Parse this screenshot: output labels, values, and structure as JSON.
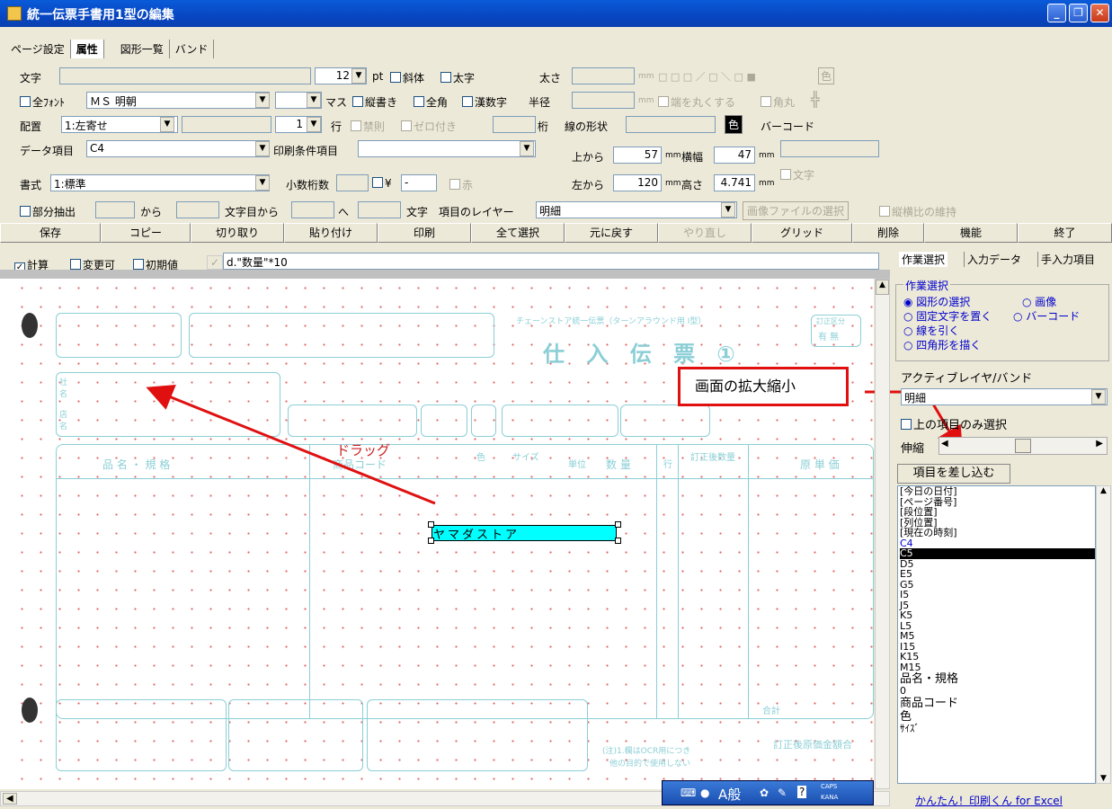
{
  "window": {
    "title": "統一伝票手書用1型の編集"
  },
  "top_tabs": [
    "ページ設定",
    "属性",
    "図形一覧",
    "バンド"
  ],
  "attr": {
    "moji_label": "文字",
    "size_value": "12",
    "pt_label": "pt",
    "italic_label": "斜体",
    "bold_label": "太字",
    "thickness_label": "太さ",
    "mm_label": "mm",
    "color_label": "色",
    "allfont_label": "全ﾌｫﾝﾄ",
    "font_value": "ＭＳ 明朝",
    "masu_label": "マス",
    "vertical_label": "縦書き",
    "fullwidth_label": "全角",
    "kanji_num_label": "漢数字",
    "radius_label": "半径",
    "round_end_label": "端を丸くする",
    "round_corner_label": "角丸",
    "align_label": "配置",
    "align_value": "1:左寄せ",
    "line_count": "1",
    "row_label": "行",
    "kinsoku_label": "禁則",
    "zero_label": "ゼロ付き",
    "digit_label": "桁",
    "line_shape_label": "線の形状",
    "barcode_label": "バーコード",
    "data_item_label": "データ項目",
    "data_item_value": "C4",
    "print_cond_label": "印刷条件項目",
    "from_top_label": "上から",
    "from_top_value": "57",
    "width_label": "横幅",
    "width_value": "47",
    "format_label": "書式",
    "format_value": "1:標準",
    "decimal_label": "小数桁数",
    "yen_label": "¥",
    "dash_value": "-",
    "red_label": "赤",
    "from_left_label": "左から",
    "from_left_value": "120",
    "height_label": "高さ",
    "height_value": "4.741",
    "text_label": "文字",
    "partial_label": "部分抽出",
    "kara_label": "から",
    "char_from_label": "文字目から",
    "he_label": "へ",
    "moji2_label": "文字",
    "layer_label": "項目のレイヤー",
    "layer_value": "明細",
    "image_file_button": "画像ファイルの選択",
    "keep_ratio_label": "縦横比の維持"
  },
  "buttons": [
    "保存",
    "コピー",
    "切り取り",
    "貼り付け",
    "印刷",
    "全て選択",
    "元に戻す",
    "やり直し",
    "グリッド",
    "削除",
    "機能",
    "終了"
  ],
  "calc": {
    "calc_label": "計算",
    "changeable_label": "変更可",
    "initial_label": "初期値",
    "formula_value": "d.\"数量\"*10"
  },
  "right_tabs": [
    "作業選択",
    "入力データ",
    "手入力項目"
  ],
  "work": {
    "group_title": "作業選択",
    "options": [
      "図形の選択",
      "画像",
      "固定文字を置く",
      "バーコード",
      "線を引く",
      "四角形を描く"
    ],
    "active_layer_label": "アクティブレイヤ/バンド",
    "active_layer_value": "明細",
    "upper_only_label": "上の項目のみ選択",
    "zoom_label": "伸縮",
    "insert_button": "項目を差し込む"
  },
  "item_list": [
    "[今日の日付]",
    "[ページ番号]",
    "[段位置]",
    "[列位置]",
    "[現在の時刻]",
    "C4",
    "C5",
    "D5",
    "E5",
    "G5",
    "I5",
    "J5",
    "K5",
    "L5",
    "M5",
    "I15",
    "K15",
    "M15",
    "品名・規格",
    "0",
    "商品コード",
    "色",
    "ｻｲｽﾞ"
  ],
  "selected_item": "C5",
  "blue_item": "C4",
  "footer_link": "かんたん！印刷くん for Excel",
  "ime": {
    "mode": "A般",
    "caps": "CAPS",
    "kana": "KANA"
  },
  "canvas": {
    "selected_field_text": "ヤマダストア",
    "callout_text": "画面の拡大縮小",
    "drag_text": "ドラッグ",
    "form_header": "チェーンストア統一伝票（ターンアラウンド用 I型）",
    "form_title": "仕 入 伝 票 ①",
    "sha": "社名",
    "ten": "店名",
    "hinmei": "品 名 ・ 規 格",
    "shohin_code": "商品コード",
    "color_col": "色",
    "size_col": "サイズ",
    "unit_col": "単位",
    "qty_col": "数 量",
    "row_col": "行",
    "corrected_qty": "訂正後数量",
    "genka": "原 単 価",
    "total": "合計",
    "note": "(注)1.欄はOCR用につき",
    "note2": "他の目的で使用しない",
    "teisei_total": "訂正後原価金額合",
    "ari_nashi": "有 無",
    "teisei_kubun": "訂正区分"
  }
}
